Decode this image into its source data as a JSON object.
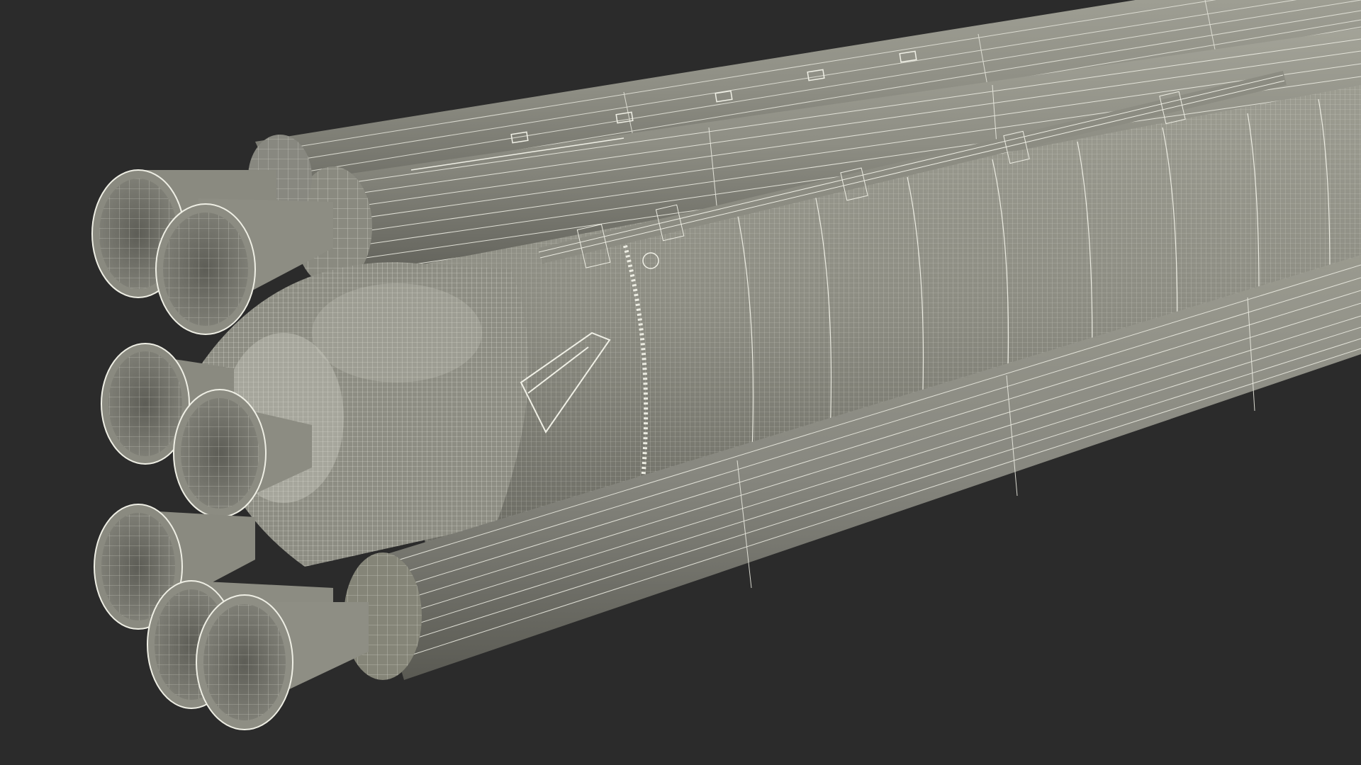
{
  "viewport": {
    "background": "#2b2b2b",
    "model_fill": "#8f8f85",
    "model_fill_dark": "#6f6f66",
    "model_fill_light": "#a6a69b",
    "wire_color": "#e8e8de",
    "subject": "rocket-wireframe-model"
  }
}
